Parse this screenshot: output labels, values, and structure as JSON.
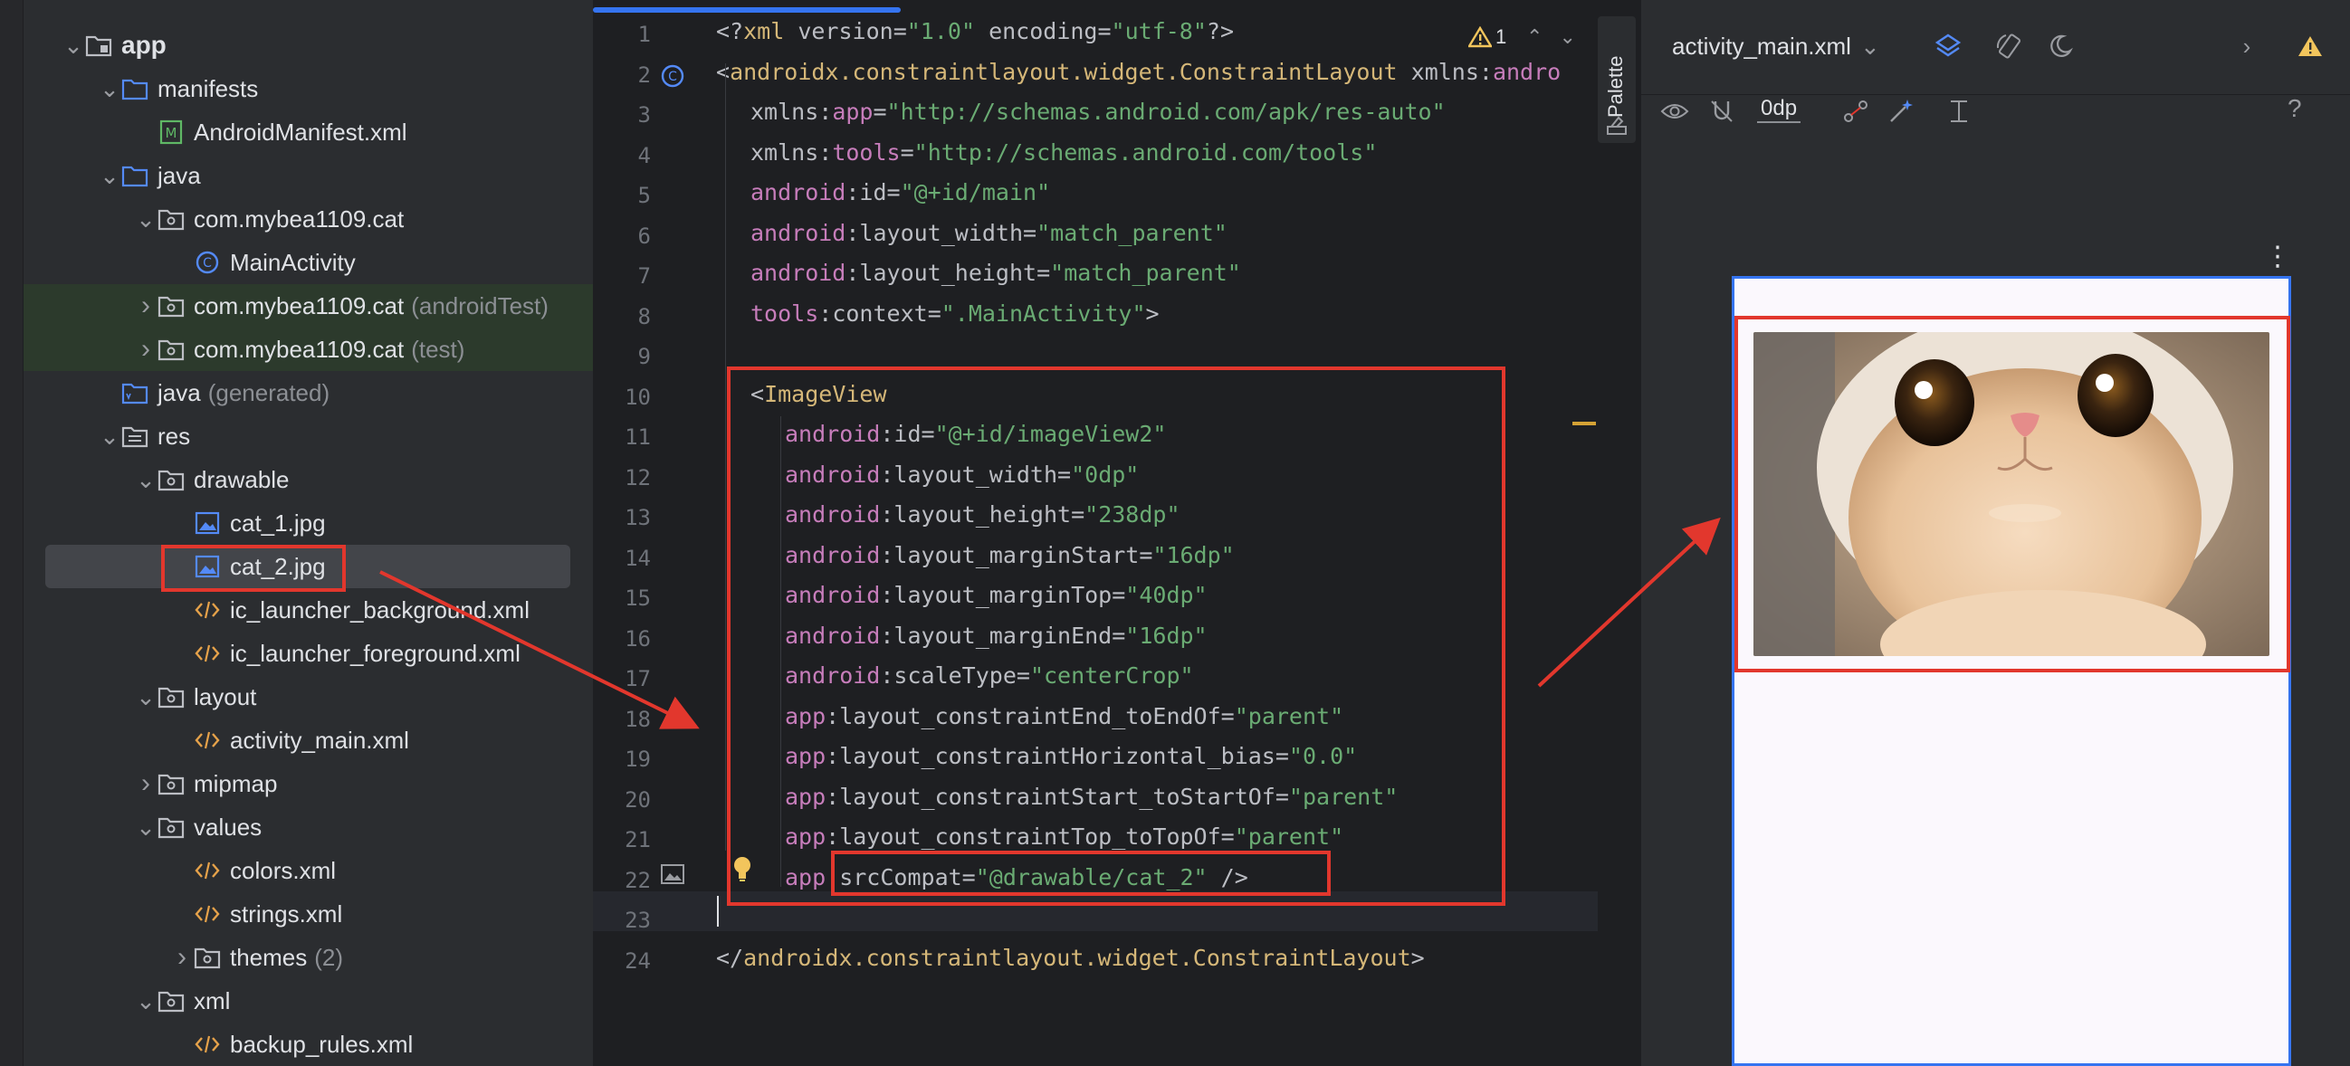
{
  "project_tree": [
    {
      "label": "app",
      "depth": 0,
      "chevron": "down",
      "icon": "module",
      "bold": true
    },
    {
      "label": "manifests",
      "depth": 1,
      "chevron": "down",
      "icon": "folder-blue"
    },
    {
      "label": "AndroidManifest.xml",
      "depth": 2,
      "chevron": "",
      "icon": "manifest-file"
    },
    {
      "label": "java",
      "depth": 1,
      "chevron": "down",
      "icon": "folder-blue"
    },
    {
      "label": "com.mybea1109.cat",
      "depth": 2,
      "chevron": "down",
      "icon": "package"
    },
    {
      "label": "MainActivity",
      "depth": 3,
      "chevron": "",
      "icon": "class-file"
    },
    {
      "label": "com.mybea1109.cat",
      "suffix": "(androidTest)",
      "depth": 2,
      "chevron": "right",
      "icon": "package",
      "highlight": "green"
    },
    {
      "label": "com.mybea1109.cat",
      "suffix": "(test)",
      "depth": 2,
      "chevron": "right",
      "icon": "package",
      "highlight": "green"
    },
    {
      "label": "java",
      "suffix": "(generated)",
      "depth": 1,
      "chevron": "",
      "icon": "folder-generated"
    },
    {
      "label": "res",
      "depth": 1,
      "chevron": "down",
      "icon": "res-folder"
    },
    {
      "label": "drawable",
      "depth": 2,
      "chevron": "down",
      "icon": "package"
    },
    {
      "label": "cat_1.jpg",
      "depth": 3,
      "chevron": "",
      "icon": "image-file"
    },
    {
      "label": "cat_2.jpg",
      "depth": 3,
      "chevron": "",
      "icon": "image-file",
      "selected": true
    },
    {
      "label": "ic_launcher_background.xml",
      "depth": 3,
      "chevron": "",
      "icon": "xml-file"
    },
    {
      "label": "ic_launcher_foreground.xml",
      "depth": 3,
      "chevron": "",
      "icon": "xml-file"
    },
    {
      "label": "layout",
      "depth": 2,
      "chevron": "down",
      "icon": "package"
    },
    {
      "label": "activity_main.xml",
      "depth": 3,
      "chevron": "",
      "icon": "xml-file"
    },
    {
      "label": "mipmap",
      "depth": 2,
      "chevron": "right",
      "icon": "package"
    },
    {
      "label": "values",
      "depth": 2,
      "chevron": "down",
      "icon": "package"
    },
    {
      "label": "colors.xml",
      "depth": 3,
      "chevron": "",
      "icon": "xml-file"
    },
    {
      "label": "strings.xml",
      "depth": 3,
      "chevron": "",
      "icon": "xml-file"
    },
    {
      "label": "themes",
      "suffix": "(2)",
      "depth": 3,
      "chevron": "right",
      "icon": "package"
    },
    {
      "label": "xml",
      "depth": 2,
      "chevron": "down",
      "icon": "package"
    },
    {
      "label": "backup_rules.xml",
      "depth": 3,
      "chevron": "",
      "icon": "xml-file"
    }
  ],
  "editor": {
    "warning_count": "1",
    "lines": [
      {
        "n": "1",
        "indent": 0,
        "tokens": [
          [
            "pun",
            "<?"
          ],
          [
            "tag",
            "xml "
          ],
          [
            "attr",
            "version"
          ],
          [
            "pun",
            "="
          ],
          [
            "str",
            "\"1.0\""
          ],
          [
            "attr",
            " encoding"
          ],
          [
            "pun",
            "="
          ],
          [
            "str",
            "\"utf-8\""
          ],
          [
            "pun",
            "?>"
          ]
        ]
      },
      {
        "n": "2",
        "indent": 0,
        "tokens": [
          [
            "pun",
            "<"
          ],
          [
            "tag",
            "androidx.constraintlayout.widget.ConstraintLayout "
          ],
          [
            "attr",
            "xmlns:"
          ],
          [
            "ns",
            "andro"
          ]
        ]
      },
      {
        "n": "3",
        "indent": 1,
        "tokens": [
          [
            "attr",
            "xmlns:"
          ],
          [
            "ns",
            "app"
          ],
          [
            "pun",
            "="
          ],
          [
            "str",
            "\"http://schemas.android.com/apk/res-auto\""
          ]
        ]
      },
      {
        "n": "4",
        "indent": 1,
        "tokens": [
          [
            "attr",
            "xmlns:"
          ],
          [
            "ns",
            "tools"
          ],
          [
            "pun",
            "="
          ],
          [
            "str",
            "\"http://schemas.android.com/tools\""
          ]
        ]
      },
      {
        "n": "5",
        "indent": 1,
        "tokens": [
          [
            "ns",
            "android"
          ],
          [
            "attr",
            ":id"
          ],
          [
            "pun",
            "="
          ],
          [
            "str",
            "\"@+id/main\""
          ]
        ]
      },
      {
        "n": "6",
        "indent": 1,
        "tokens": [
          [
            "ns",
            "android"
          ],
          [
            "attr",
            ":layout_width"
          ],
          [
            "pun",
            "="
          ],
          [
            "str",
            "\"match_parent\""
          ]
        ]
      },
      {
        "n": "7",
        "indent": 1,
        "tokens": [
          [
            "ns",
            "android"
          ],
          [
            "attr",
            ":layout_height"
          ],
          [
            "pun",
            "="
          ],
          [
            "str",
            "\"match_parent\""
          ]
        ]
      },
      {
        "n": "8",
        "indent": 1,
        "tokens": [
          [
            "ns",
            "tools"
          ],
          [
            "attr",
            ":context"
          ],
          [
            "pun",
            "="
          ],
          [
            "str",
            "\".MainActivity\""
          ],
          [
            "pun",
            ">"
          ]
        ]
      },
      {
        "n": "9",
        "indent": 0,
        "tokens": []
      },
      {
        "n": "10",
        "indent": 1,
        "tokens": [
          [
            "pun",
            "<"
          ],
          [
            "tag",
            "ImageView"
          ]
        ]
      },
      {
        "n": "11",
        "indent": 2,
        "tokens": [
          [
            "ns",
            "android"
          ],
          [
            "attr",
            ":id"
          ],
          [
            "pun",
            "="
          ],
          [
            "str",
            "\"@+id/imageView2\""
          ]
        ]
      },
      {
        "n": "12",
        "indent": 2,
        "tokens": [
          [
            "ns",
            "android"
          ],
          [
            "attr",
            ":layout_width"
          ],
          [
            "pun",
            "="
          ],
          [
            "str",
            "\"0dp\""
          ]
        ]
      },
      {
        "n": "13",
        "indent": 2,
        "tokens": [
          [
            "ns",
            "android"
          ],
          [
            "attr",
            ":layout_height"
          ],
          [
            "pun",
            "="
          ],
          [
            "str",
            "\"238dp\""
          ]
        ]
      },
      {
        "n": "14",
        "indent": 2,
        "tokens": [
          [
            "ns",
            "android"
          ],
          [
            "attr",
            ":layout_marginStart"
          ],
          [
            "pun",
            "="
          ],
          [
            "str",
            "\"16dp\""
          ]
        ]
      },
      {
        "n": "15",
        "indent": 2,
        "tokens": [
          [
            "ns",
            "android"
          ],
          [
            "attr",
            ":layout_marginTop"
          ],
          [
            "pun",
            "="
          ],
          [
            "str",
            "\"40dp\""
          ]
        ]
      },
      {
        "n": "16",
        "indent": 2,
        "tokens": [
          [
            "ns",
            "android"
          ],
          [
            "attr",
            ":layout_marginEnd"
          ],
          [
            "pun",
            "="
          ],
          [
            "str",
            "\"16dp\""
          ]
        ]
      },
      {
        "n": "17",
        "indent": 2,
        "tokens": [
          [
            "ns",
            "android"
          ],
          [
            "attr",
            ":scaleType"
          ],
          [
            "pun",
            "="
          ],
          [
            "str",
            "\"centerCrop\""
          ]
        ]
      },
      {
        "n": "18",
        "indent": 2,
        "tokens": [
          [
            "ns",
            "app"
          ],
          [
            "attr",
            ":layout_constraintEnd_toEndOf"
          ],
          [
            "pun",
            "="
          ],
          [
            "str",
            "\"parent\""
          ]
        ]
      },
      {
        "n": "19",
        "indent": 2,
        "tokens": [
          [
            "ns",
            "app"
          ],
          [
            "attr",
            ":layout_constraintHorizontal_bias"
          ],
          [
            "pun",
            "="
          ],
          [
            "str",
            "\"0.0\""
          ]
        ]
      },
      {
        "n": "20",
        "indent": 2,
        "tokens": [
          [
            "ns",
            "app"
          ],
          [
            "attr",
            ":layout_constraintStart_toStartOf"
          ],
          [
            "pun",
            "="
          ],
          [
            "str",
            "\"parent\""
          ]
        ]
      },
      {
        "n": "21",
        "indent": 2,
        "tokens": [
          [
            "ns",
            "app"
          ],
          [
            "attr",
            ":layout_constraintTop_toTopOf"
          ],
          [
            "pun",
            "="
          ],
          [
            "str",
            "\"parent\""
          ]
        ]
      },
      {
        "n": "22",
        "indent": 2,
        "tokens": [
          [
            "ns",
            "app"
          ],
          [
            "attr",
            ":srcCompat"
          ],
          [
            "pun",
            "="
          ],
          [
            "str",
            "\"@drawable/cat_2\""
          ],
          [
            "pun",
            " />"
          ]
        ]
      },
      {
        "n": "23",
        "indent": 0,
        "tokens": []
      },
      {
        "n": "24",
        "indent": 0,
        "tokens": [
          [
            "pun",
            "</"
          ],
          [
            "tag",
            "androidx.constraintlayout.widget.ConstraintLayout"
          ],
          [
            "pun",
            ">"
          ]
        ]
      }
    ]
  },
  "palette": {
    "label": "Palette"
  },
  "design": {
    "file_name": "activity_main.xml",
    "zoom_label": "0dp",
    "help_label": "?"
  },
  "colors": {
    "accent": "#3574f0",
    "annotation": "#e2372d",
    "string": "#6aab73",
    "namespace": "#c77dbb",
    "tag": "#d5b778"
  }
}
